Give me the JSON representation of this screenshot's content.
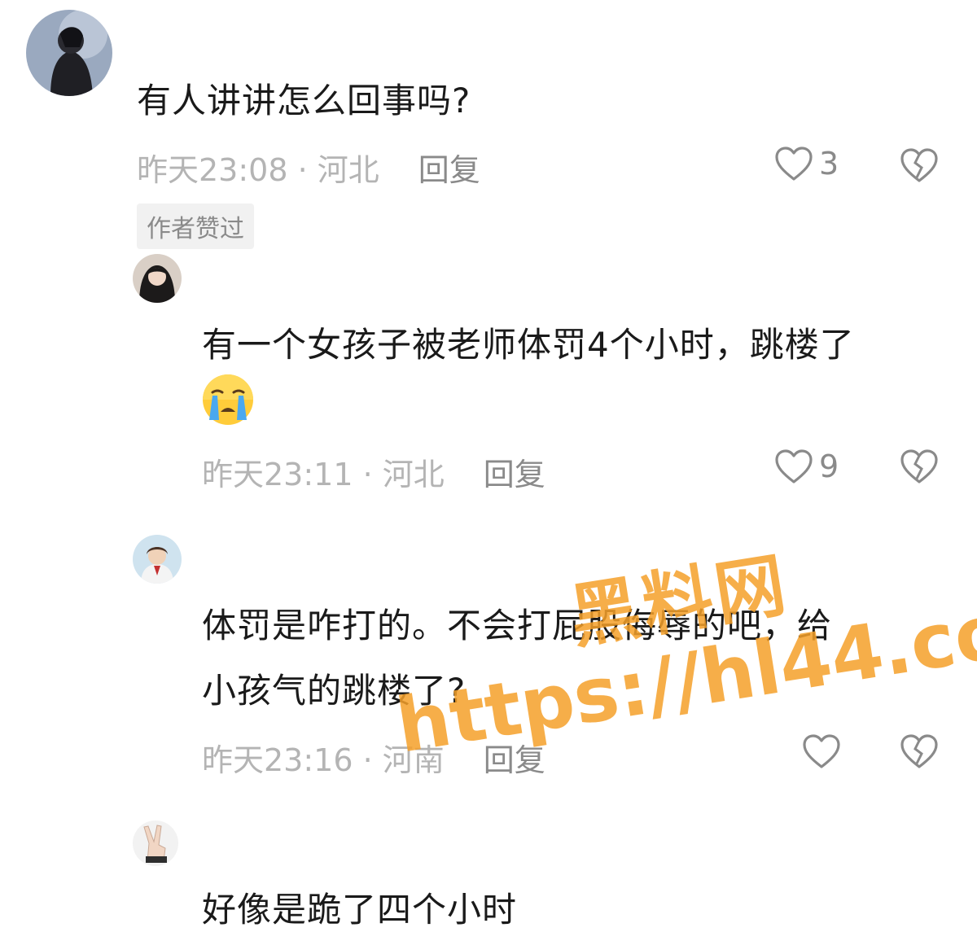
{
  "comments": [
    {
      "text": "有人讲讲怎么回事吗?",
      "meta": "昨天23:08 · 河北",
      "reply_label": "回复",
      "like_count": "3",
      "badge": "作者赞过"
    },
    {
      "text_line1": "有一个女孩子被老师体罚4个小时，跳楼了",
      "emoji": "crying-face",
      "meta": "昨天23:11 · 河北",
      "reply_label": "回复",
      "like_count": "9"
    },
    {
      "text_line1": "体罚是咋打的。不会打屁股侮辱的吧，给",
      "text_line2": "小孩气的跳楼了?",
      "meta": "昨天23:16 · 河南",
      "reply_label": "回复",
      "like_count": ""
    },
    {
      "text": "好像是跪了四个小时"
    }
  ],
  "watermark": {
    "line1": "黑料网",
    "line2": "https://hl44.co"
  },
  "colors": {
    "text": "#1a1a1a",
    "meta": "#b4b4b4",
    "action": "#8a8a8a",
    "badge_bg": "#f1f1f1",
    "watermark": "#f5a02a"
  }
}
